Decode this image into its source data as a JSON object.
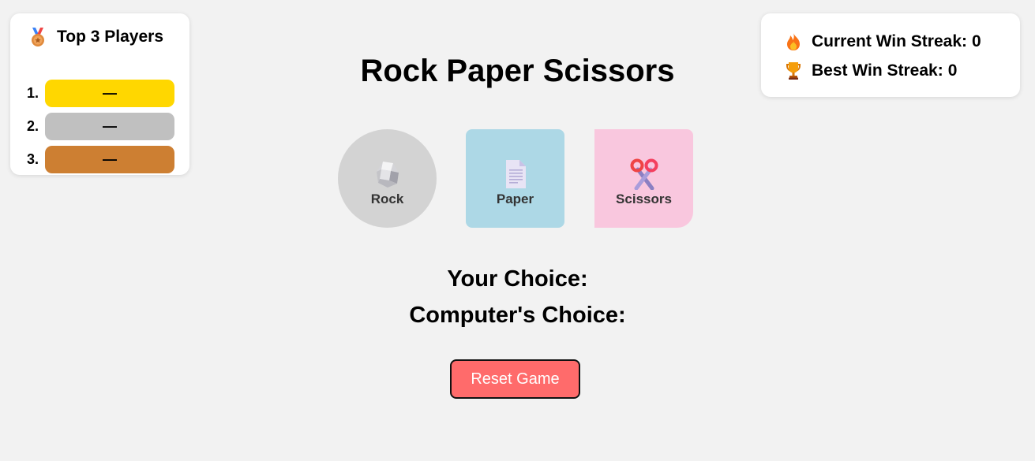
{
  "leaderboard": {
    "title": "Top 3 Players",
    "icon": "medal-icon",
    "entries": [
      {
        "rank": "1.",
        "name": "—",
        "color": "#ffd700"
      },
      {
        "rank": "2.",
        "name": "—",
        "color": "#c0c0c0"
      },
      {
        "rank": "3.",
        "name": "—",
        "color": "#cd7f32"
      }
    ]
  },
  "streak": {
    "current_label": "Current Win Streak:",
    "current_value": "0",
    "current_icon": "fire-icon",
    "best_label": "Best Win Streak:",
    "best_value": "0",
    "best_icon": "trophy-icon"
  },
  "game": {
    "title": "Rock Paper Scissors",
    "choices": [
      {
        "label": "Rock",
        "icon": "rock-icon",
        "color": "#d3d3d3"
      },
      {
        "label": "Paper",
        "icon": "paper-icon",
        "color": "#add8e6"
      },
      {
        "label": "Scissors",
        "icon": "scissors-icon",
        "color": "#f9c7de"
      }
    ],
    "your_choice_label": "Your Choice:",
    "your_choice_value": "",
    "computer_choice_label": "Computer's Choice:",
    "computer_choice_value": "",
    "reset_label": "Reset Game",
    "reset_color": "#ff6b6b"
  }
}
